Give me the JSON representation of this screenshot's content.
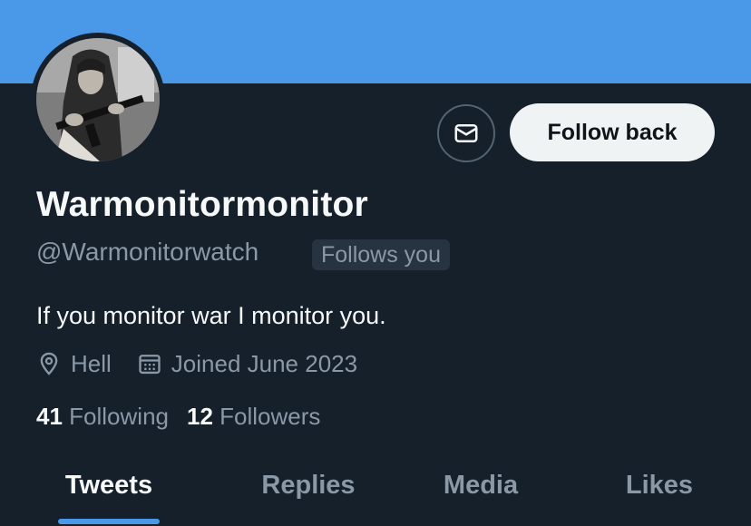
{
  "profile": {
    "display_name": "Warmonitormonitor",
    "handle": "@Warmonitorwatch",
    "follows_you": "Follows you",
    "bio": "If you monitor war I monitor you.",
    "location": "Hell",
    "joined": "Joined June 2023",
    "following_count": "41",
    "following_label": "Following",
    "followers_count": "12",
    "followers_label": "Followers"
  },
  "actions": {
    "follow_back_label": "Follow back",
    "message_icon": "envelope-icon"
  },
  "tabs": [
    {
      "label": "Tweets",
      "active": true
    },
    {
      "label": "Replies",
      "active": false
    },
    {
      "label": "Media",
      "active": false
    },
    {
      "label": "Likes",
      "active": false
    }
  ],
  "colors": {
    "background": "#15202b",
    "banner": "#4a99e9",
    "accent": "#4a99e9",
    "primary_text": "#f7f9f9",
    "secondary_text": "#8b98a5",
    "button_bg": "#eff3f4"
  }
}
